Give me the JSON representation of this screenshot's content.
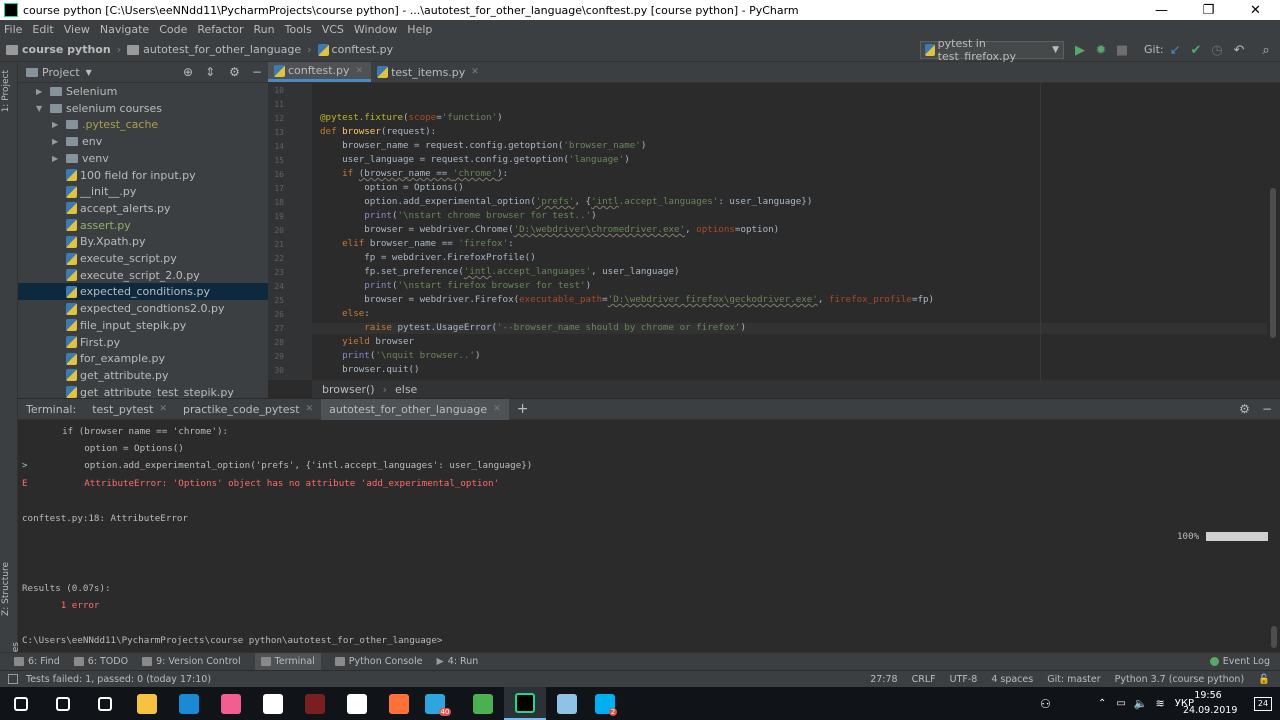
{
  "window": {
    "title": "course python [C:\\Users\\eeNNdd11\\PycharmProjects\\course python] - ...\\autotest_for_other_language\\conftest.py [course python] - PyCharm",
    "minimize": "—",
    "maximize": "❐",
    "close": "✕"
  },
  "menu": [
    "File",
    "Edit",
    "View",
    "Navigate",
    "Code",
    "Refactor",
    "Run",
    "Tools",
    "VCS",
    "Window",
    "Help"
  ],
  "navbar": {
    "crumbs": [
      "course python",
      "autotest_for_other_language",
      "conftest.py"
    ],
    "run_config": "pytest in test_firefox.py",
    "git_label": "Git:"
  },
  "left_strip": {
    "project": "1: Project",
    "structure": "Z: Structure",
    "favorites": "2: Favorites"
  },
  "project_panel": {
    "title": "Project",
    "tree": [
      {
        "label": "Selenium",
        "kind": "folder",
        "depth": 1,
        "arrow": "▶"
      },
      {
        "label": "selenium courses",
        "kind": "folder",
        "depth": 1,
        "arrow": "▼"
      },
      {
        "label": ".pytest_cache",
        "kind": "folder",
        "depth": 2,
        "arrow": "▶",
        "color": "#a8a04c"
      },
      {
        "label": "env",
        "kind": "folder",
        "depth": 2,
        "arrow": "▶"
      },
      {
        "label": "venv",
        "kind": "folder",
        "depth": 2,
        "arrow": "▶"
      },
      {
        "label": "100 field for input.py",
        "kind": "file",
        "depth": 2
      },
      {
        "label": "__init__.py",
        "kind": "file",
        "depth": 2
      },
      {
        "label": "accept_alerts.py",
        "kind": "file",
        "depth": 2
      },
      {
        "label": "assert.py",
        "kind": "file",
        "depth": 2,
        "color": "#8fb366"
      },
      {
        "label": "By.Xpath.py",
        "kind": "file",
        "depth": 2
      },
      {
        "label": "execute_script.py",
        "kind": "file",
        "depth": 2
      },
      {
        "label": "execute_script_2.0.py",
        "kind": "file",
        "depth": 2
      },
      {
        "label": "expected_conditions.py",
        "kind": "file",
        "depth": 2,
        "selected": true
      },
      {
        "label": "expected_condtions2.0.py",
        "kind": "file",
        "depth": 2
      },
      {
        "label": "file_input_stepik.py",
        "kind": "file",
        "depth": 2
      },
      {
        "label": "First.py",
        "kind": "file",
        "depth": 2
      },
      {
        "label": "for_example.py",
        "kind": "file",
        "depth": 2
      },
      {
        "label": "get_attribute.py",
        "kind": "file",
        "depth": 2
      },
      {
        "label": "get_attribute_test_stepik.py",
        "kind": "file",
        "depth": 2
      }
    ]
  },
  "editor": {
    "tabs": [
      {
        "label": "conftest.py",
        "active": true
      },
      {
        "label": "test_items.py",
        "active": false
      }
    ],
    "line_numbers": [
      "10",
      "11",
      "12",
      "13",
      "14",
      "15",
      "16",
      "17",
      "18",
      "19",
      "20",
      "21",
      "22",
      "23",
      "24",
      "25",
      "26",
      "27",
      "28",
      "29",
      "30"
    ],
    "breadcrumbs": [
      "browser()",
      "else"
    ]
  },
  "terminal": {
    "label": "Terminal:",
    "tabs": [
      {
        "label": "test_pytest",
        "active": false
      },
      {
        "label": "practike_code_pytest",
        "active": false
      },
      {
        "label": "autotest_for_other_language",
        "active": true
      }
    ],
    "lines": [
      {
        "prefix": "",
        "text": "    if (browser name == 'chrome'):",
        "error": false
      },
      {
        "prefix": "",
        "text": "        option = Options()",
        "error": false
      },
      {
        "prefix": ">",
        "text": "        option.add_experimental_option('prefs', {'intl.accept_languages': user_language})",
        "error": false
      },
      {
        "prefix": "E",
        "text": "        AttributeError: 'Options' object has no attribute 'add_experimental_option'",
        "error": true
      },
      {
        "prefix": "",
        "text": "conftest.py:18: AttributeError",
        "error": false
      },
      {
        "prefix": "",
        "text": "Results (0.07s):",
        "error": false
      },
      {
        "prefix": "",
        "text": "       1 error",
        "error": true
      },
      {
        "prefix": "",
        "text": "C:\\Users\\eeNNdd11\\PycharmProjects\\course python\\autotest_for_other_language>",
        "error": false
      }
    ],
    "progress_label": "100%",
    "progress": 1.0
  },
  "tool_tabs": [
    {
      "label": "6: Find",
      "active": false
    },
    {
      "label": "6: TODO",
      "active": false
    },
    {
      "label": "9: Version Control",
      "active": false
    },
    {
      "label": "Terminal",
      "active": true
    },
    {
      "label": "Python Console",
      "active": false
    },
    {
      "label": "4: Run",
      "active": false
    }
  ],
  "event_log": "Event Log",
  "status": {
    "message": "Tests failed: 1, passed: 0 (today 17:10)",
    "position": "27:78",
    "line_sep": "CRLF",
    "encoding": "UTF-8",
    "indent": "4 spaces",
    "git": "Git: master",
    "interpreter": "Python 3.7 (course python)"
  },
  "taskbar": {
    "apps": [
      {
        "name": "start-icon",
        "color": "#ffffff"
      },
      {
        "name": "search-icon",
        "color": "#ffffff"
      },
      {
        "name": "task-view-icon",
        "color": "#ffffff"
      },
      {
        "name": "file-explorer-icon",
        "color": "#f5c242"
      },
      {
        "name": "edge-icon",
        "color": "#1a8ad4"
      },
      {
        "name": "itunes-icon",
        "color": "#f25e8f"
      },
      {
        "name": "store-icon",
        "color": "#ffffff"
      },
      {
        "name": "app-dark-icon",
        "color": "#7a1f1f"
      },
      {
        "name": "mail-icon",
        "color": "#ffffff"
      },
      {
        "name": "firefox-icon",
        "color": "#ff7139"
      },
      {
        "name": "telegram-icon",
        "color": "#2ca5e0"
      },
      {
        "name": "chrome-icon",
        "color": "#4caf50"
      },
      {
        "name": "pycharm-icon",
        "color": "#21d789"
      },
      {
        "name": "notepad-icon",
        "color": "#8fc3e6"
      },
      {
        "name": "skype-icon",
        "color": "#00aff0"
      }
    ],
    "telegram_badge": "40",
    "skype_badge": "2",
    "language": "УКР",
    "time": "19:56",
    "date": "24.09.2019",
    "notifications": "24"
  }
}
